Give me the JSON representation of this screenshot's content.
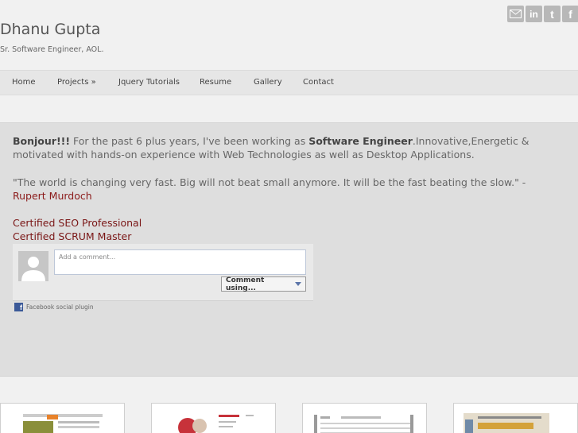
{
  "header": {
    "title": "Dhanu Gupta",
    "tagline": "Sr. Software Engineer, AOL."
  },
  "social": [
    {
      "icon": "mail-icon",
      "label": ""
    },
    {
      "icon": "linkedin-icon",
      "label": "in"
    },
    {
      "icon": "twitter-icon",
      "label": "t"
    },
    {
      "icon": "facebook-icon",
      "label": "f"
    }
  ],
  "nav": {
    "items": [
      "Home",
      "Projects »",
      "Jquery Tutorials",
      "Resume",
      "Gallery",
      "Contact"
    ]
  },
  "intro": {
    "greeting": "Bonjour!!!",
    "text_before": " For the past 6 plus years, I've been working as ",
    "role": "Software Engineer",
    "text_after": ".Innovative,Energetic & motivated with hands-on experience with Web Technologies as well as Desktop Applications.",
    "quote": "\"The world is changing very fast. Big will not beat small anymore. It will be the fast beating the slow.\" - ",
    "quote_author": "Rupert Murdoch"
  },
  "certifications": [
    "Certified SEO Professional",
    "Certified SCRUM Master"
  ],
  "comments": {
    "placeholder": "Add a comment...",
    "button_label": "Comment using...",
    "plugin_label": "Facebook social plugin"
  },
  "gallery": {
    "thumbnails": [
      "thumbnail-1",
      "thumbnail-2",
      "thumbnail-3",
      "thumbnail-4"
    ]
  },
  "colors": {
    "accent": "#7a1616",
    "background": "#f1f1f1",
    "hero_background": "#dedede",
    "facebook_blue": "#3b5998"
  }
}
